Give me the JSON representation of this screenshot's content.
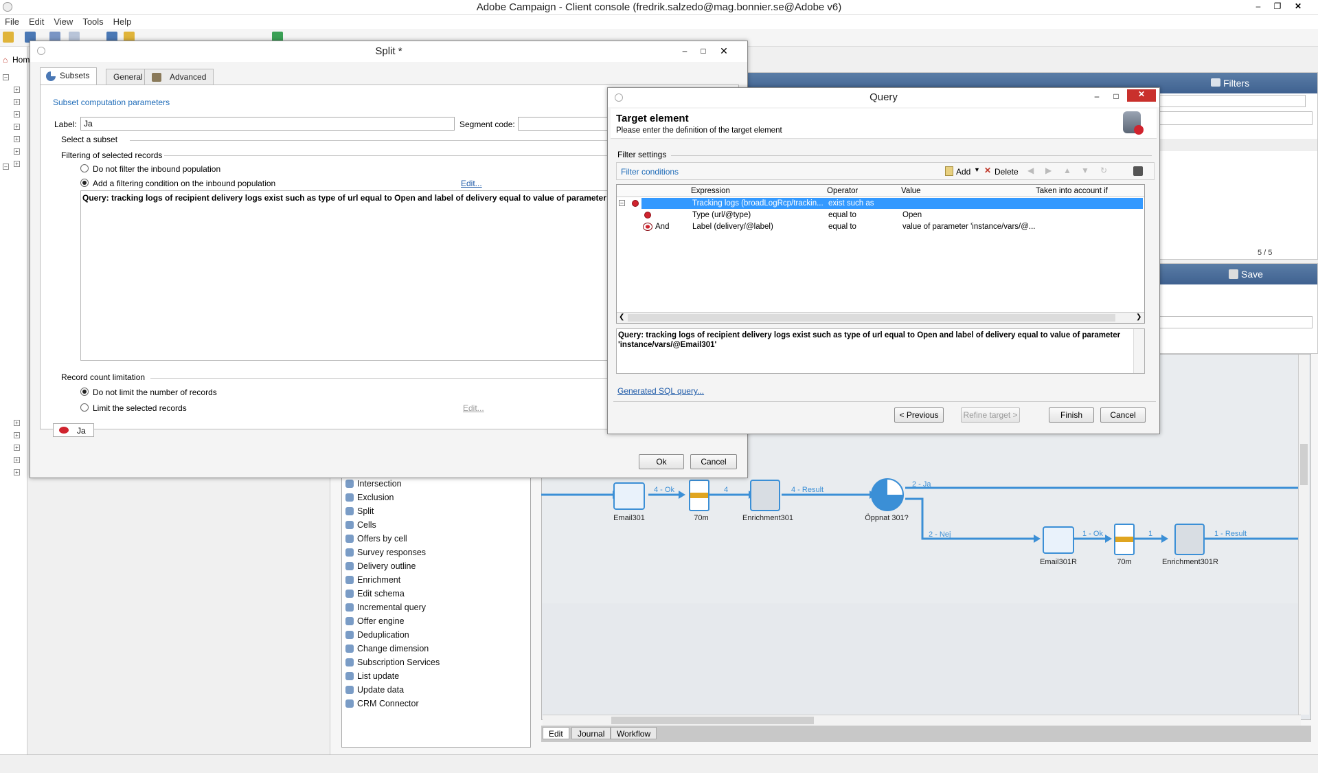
{
  "app": {
    "title": "Adobe Campaign - Client console (fredrik.salzedo@mag.bonnier.se@Adobe v6)",
    "menu": [
      "File",
      "Edit",
      "View",
      "Tools",
      "Help"
    ],
    "home_label": "Hom"
  },
  "background": {
    "filters_label": "Filters",
    "save_label": "Save",
    "pager": "5 / 5",
    "activities": [
      "Intersection",
      "Exclusion",
      "Split",
      "Cells",
      "Offers by cell",
      "Survey responses",
      "Delivery outline",
      "Enrichment",
      "Edit schema",
      "Incremental query",
      "Offer engine",
      "Deduplication",
      "Change dimension",
      "Subscription Services",
      "List update",
      "Update data",
      "CRM Connector"
    ],
    "workflow_nodes": {
      "email301": "Email301",
      "wait1": "70m",
      "enrich301": "Enrichment301",
      "oppnat": "Öppnat 301?",
      "email301r": "Email301R",
      "wait2": "70m",
      "enrich301r": "Enrichment301R"
    },
    "transitions": {
      "t1": "4 - Ok",
      "t2": "4",
      "t3": "4 - Result",
      "t4": "2 - Ja",
      "t5": "2 - Nej",
      "t6": "1 - Ok",
      "t7": "1",
      "t8": "1 - Result"
    },
    "bottom_tabs": [
      "Edit",
      "Journal",
      "Workflow"
    ]
  },
  "split": {
    "title": "Split *",
    "tabs": [
      "Subsets",
      "General",
      "Advanced"
    ],
    "section": "Subset computation parameters",
    "label_caption": "Label:",
    "label_value": "Ja",
    "segment_caption": "Segment code:",
    "select_subset": "Select a subset",
    "filtering_group": "Filtering of selected records",
    "opt_no_filter": "Do not filter the inbound population",
    "opt_add_filter": "Add a filtering condition on the inbound population",
    "edit_link": "Edit...",
    "query_text": "Query: tracking logs of recipient delivery logs exist such as type of url equal to Open and label of delivery equal to value of parameter 'inst",
    "record_group": "Record count limitation",
    "opt_no_limit": "Do not limit the number of records",
    "opt_limit": "Limit the selected records",
    "edit_link2": "Edit...",
    "subset_item": "Ja",
    "ok": "Ok",
    "cancel": "Cancel"
  },
  "query": {
    "title": "Query",
    "heading": "Target element",
    "subheading": "Please enter the definition of the target element",
    "filter_settings": "Filter settings",
    "filter_conditions": "Filter conditions",
    "add": "Add",
    "delete": "Delete",
    "columns": [
      "Expression",
      "Operator",
      "Value",
      "Taken into account if"
    ],
    "rows": [
      {
        "conj": "",
        "expr": "Tracking logs (broadLogRcp/trackin...",
        "op": "exist such as",
        "val": ""
      },
      {
        "conj": "",
        "expr": "Type (url/@type)",
        "op": "equal to",
        "val": "Open"
      },
      {
        "conj": "And",
        "expr": "Label (delivery/@label)",
        "op": "equal to",
        "val": "value of parameter 'instance/vars/@..."
      }
    ],
    "query_text": "Query: tracking logs of recipient delivery logs exist such as type of url equal to Open and label of delivery equal to value of parameter 'instance/vars/@Email301'",
    "sql_link": "Generated SQL query...",
    "prev": "< Previous",
    "refine": "Refine target >",
    "finish": "Finish",
    "cancel": "Cancel"
  },
  "colors": {
    "accent": "#3b8fd6",
    "red": "#d0232e",
    "selection": "#3399ff"
  }
}
